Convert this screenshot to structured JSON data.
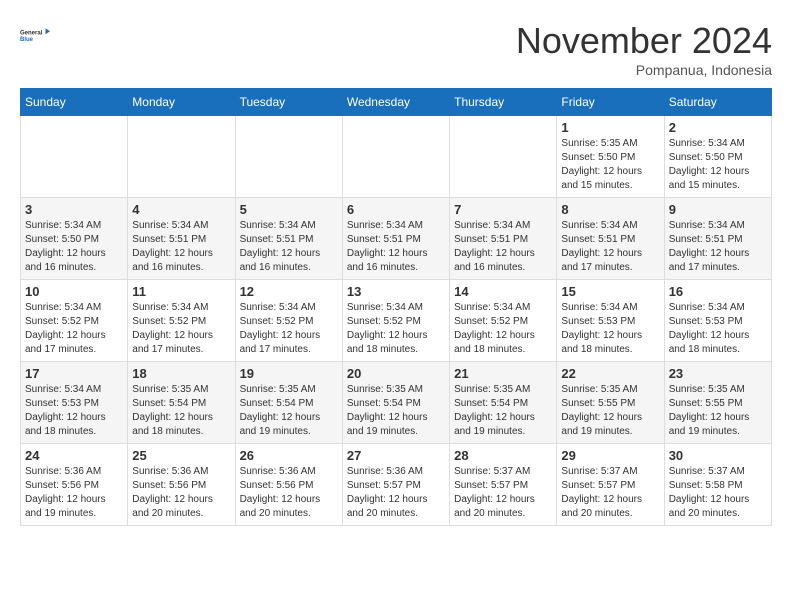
{
  "logo": {
    "text_general": "General",
    "text_blue": "Blue"
  },
  "title": "November 2024",
  "location": "Pompanua, Indonesia",
  "weekdays": [
    "Sunday",
    "Monday",
    "Tuesday",
    "Wednesday",
    "Thursday",
    "Friday",
    "Saturday"
  ],
  "weeks": [
    [
      {
        "day": "",
        "info": ""
      },
      {
        "day": "",
        "info": ""
      },
      {
        "day": "",
        "info": ""
      },
      {
        "day": "",
        "info": ""
      },
      {
        "day": "",
        "info": ""
      },
      {
        "day": "1",
        "info": "Sunrise: 5:35 AM\nSunset: 5:50 PM\nDaylight: 12 hours\nand 15 minutes."
      },
      {
        "day": "2",
        "info": "Sunrise: 5:34 AM\nSunset: 5:50 PM\nDaylight: 12 hours\nand 15 minutes."
      }
    ],
    [
      {
        "day": "3",
        "info": "Sunrise: 5:34 AM\nSunset: 5:50 PM\nDaylight: 12 hours\nand 16 minutes."
      },
      {
        "day": "4",
        "info": "Sunrise: 5:34 AM\nSunset: 5:51 PM\nDaylight: 12 hours\nand 16 minutes."
      },
      {
        "day": "5",
        "info": "Sunrise: 5:34 AM\nSunset: 5:51 PM\nDaylight: 12 hours\nand 16 minutes."
      },
      {
        "day": "6",
        "info": "Sunrise: 5:34 AM\nSunset: 5:51 PM\nDaylight: 12 hours\nand 16 minutes."
      },
      {
        "day": "7",
        "info": "Sunrise: 5:34 AM\nSunset: 5:51 PM\nDaylight: 12 hours\nand 16 minutes."
      },
      {
        "day": "8",
        "info": "Sunrise: 5:34 AM\nSunset: 5:51 PM\nDaylight: 12 hours\nand 17 minutes."
      },
      {
        "day": "9",
        "info": "Sunrise: 5:34 AM\nSunset: 5:51 PM\nDaylight: 12 hours\nand 17 minutes."
      }
    ],
    [
      {
        "day": "10",
        "info": "Sunrise: 5:34 AM\nSunset: 5:52 PM\nDaylight: 12 hours\nand 17 minutes."
      },
      {
        "day": "11",
        "info": "Sunrise: 5:34 AM\nSunset: 5:52 PM\nDaylight: 12 hours\nand 17 minutes."
      },
      {
        "day": "12",
        "info": "Sunrise: 5:34 AM\nSunset: 5:52 PM\nDaylight: 12 hours\nand 17 minutes."
      },
      {
        "day": "13",
        "info": "Sunrise: 5:34 AM\nSunset: 5:52 PM\nDaylight: 12 hours\nand 18 minutes."
      },
      {
        "day": "14",
        "info": "Sunrise: 5:34 AM\nSunset: 5:52 PM\nDaylight: 12 hours\nand 18 minutes."
      },
      {
        "day": "15",
        "info": "Sunrise: 5:34 AM\nSunset: 5:53 PM\nDaylight: 12 hours\nand 18 minutes."
      },
      {
        "day": "16",
        "info": "Sunrise: 5:34 AM\nSunset: 5:53 PM\nDaylight: 12 hours\nand 18 minutes."
      }
    ],
    [
      {
        "day": "17",
        "info": "Sunrise: 5:34 AM\nSunset: 5:53 PM\nDaylight: 12 hours\nand 18 minutes."
      },
      {
        "day": "18",
        "info": "Sunrise: 5:35 AM\nSunset: 5:54 PM\nDaylight: 12 hours\nand 18 minutes."
      },
      {
        "day": "19",
        "info": "Sunrise: 5:35 AM\nSunset: 5:54 PM\nDaylight: 12 hours\nand 19 minutes."
      },
      {
        "day": "20",
        "info": "Sunrise: 5:35 AM\nSunset: 5:54 PM\nDaylight: 12 hours\nand 19 minutes."
      },
      {
        "day": "21",
        "info": "Sunrise: 5:35 AM\nSunset: 5:54 PM\nDaylight: 12 hours\nand 19 minutes."
      },
      {
        "day": "22",
        "info": "Sunrise: 5:35 AM\nSunset: 5:55 PM\nDaylight: 12 hours\nand 19 minutes."
      },
      {
        "day": "23",
        "info": "Sunrise: 5:35 AM\nSunset: 5:55 PM\nDaylight: 12 hours\nand 19 minutes."
      }
    ],
    [
      {
        "day": "24",
        "info": "Sunrise: 5:36 AM\nSunset: 5:56 PM\nDaylight: 12 hours\nand 19 minutes."
      },
      {
        "day": "25",
        "info": "Sunrise: 5:36 AM\nSunset: 5:56 PM\nDaylight: 12 hours\nand 20 minutes."
      },
      {
        "day": "26",
        "info": "Sunrise: 5:36 AM\nSunset: 5:56 PM\nDaylight: 12 hours\nand 20 minutes."
      },
      {
        "day": "27",
        "info": "Sunrise: 5:36 AM\nSunset: 5:57 PM\nDaylight: 12 hours\nand 20 minutes."
      },
      {
        "day": "28",
        "info": "Sunrise: 5:37 AM\nSunset: 5:57 PM\nDaylight: 12 hours\nand 20 minutes."
      },
      {
        "day": "29",
        "info": "Sunrise: 5:37 AM\nSunset: 5:57 PM\nDaylight: 12 hours\nand 20 minutes."
      },
      {
        "day": "30",
        "info": "Sunrise: 5:37 AM\nSunset: 5:58 PM\nDaylight: 12 hours\nand 20 minutes."
      }
    ]
  ]
}
